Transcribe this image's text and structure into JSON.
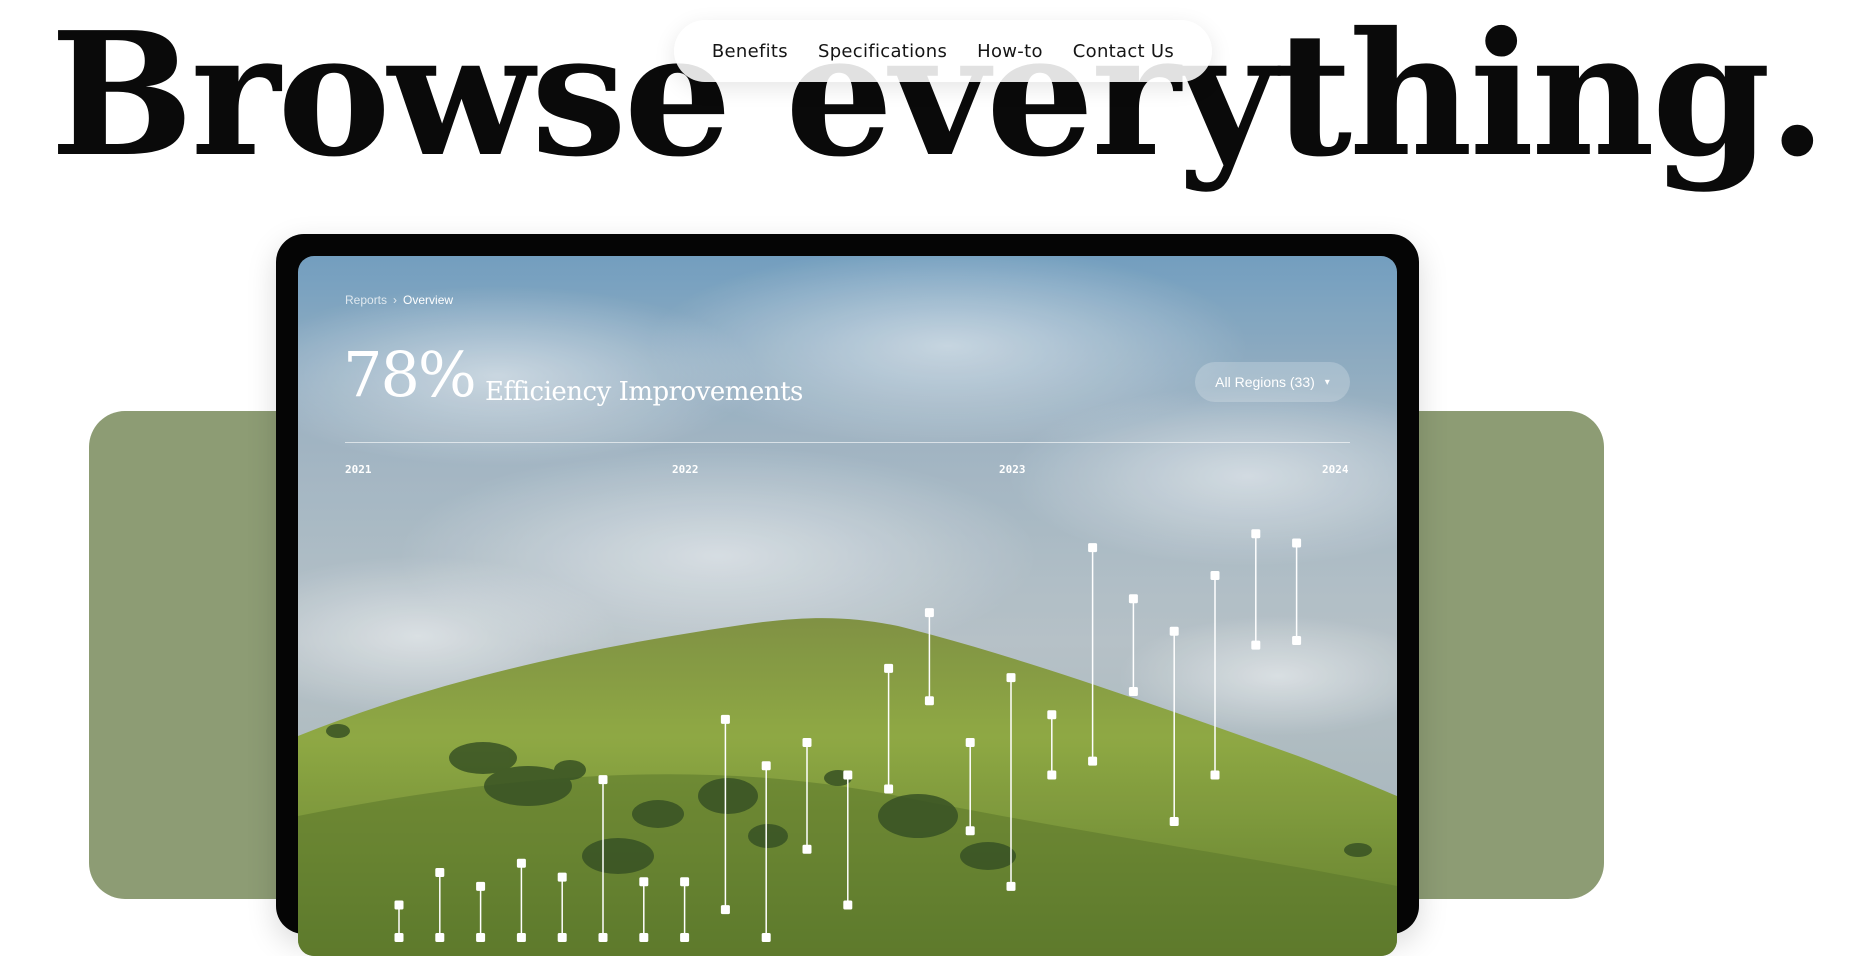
{
  "hero": {
    "title": "Browse everything."
  },
  "nav": {
    "items": [
      "Benefits",
      "Specifications",
      "How-to",
      "Contact Us"
    ]
  },
  "dashboard": {
    "breadcrumb": {
      "parent": "Reports",
      "separator": "›",
      "current": "Overview"
    },
    "stat": {
      "value": "78%",
      "label": "Efficiency Improvements"
    },
    "region_select": {
      "label": "All Regions (33)",
      "caret": "▾"
    },
    "years": [
      "2021",
      "2022",
      "2023",
      "2024"
    ]
  },
  "colors": {
    "panel_green": "#8d9c74",
    "device_black": "#050505",
    "marker_white": "#ffffff"
  },
  "chart_data": {
    "type": "range",
    "series": [
      {
        "values": [
          [
            0.11,
            0.04
          ],
          [
            0.18,
            0.04
          ],
          [
            0.15,
            0.04
          ],
          [
            0.2,
            0.04
          ],
          [
            0.17,
            0.04
          ],
          [
            0.38,
            0.04
          ],
          [
            0.16,
            0.04
          ],
          [
            0.16,
            0.04
          ],
          [
            0.51,
            0.1
          ],
          [
            0.41,
            0.04
          ],
          [
            0.46,
            0.23
          ],
          [
            0.39,
            0.11
          ],
          [
            0.62,
            0.36
          ],
          [
            0.74,
            0.55
          ],
          [
            0.46,
            0.27
          ],
          [
            0.6,
            0.15
          ],
          [
            0.52,
            0.39
          ],
          [
            0.88,
            0.42
          ],
          [
            0.77,
            0.57
          ],
          [
            0.7,
            0.29
          ],
          [
            0.82,
            0.39
          ],
          [
            0.91,
            0.67
          ],
          [
            0.89,
            0.68
          ]
        ]
      }
    ]
  }
}
